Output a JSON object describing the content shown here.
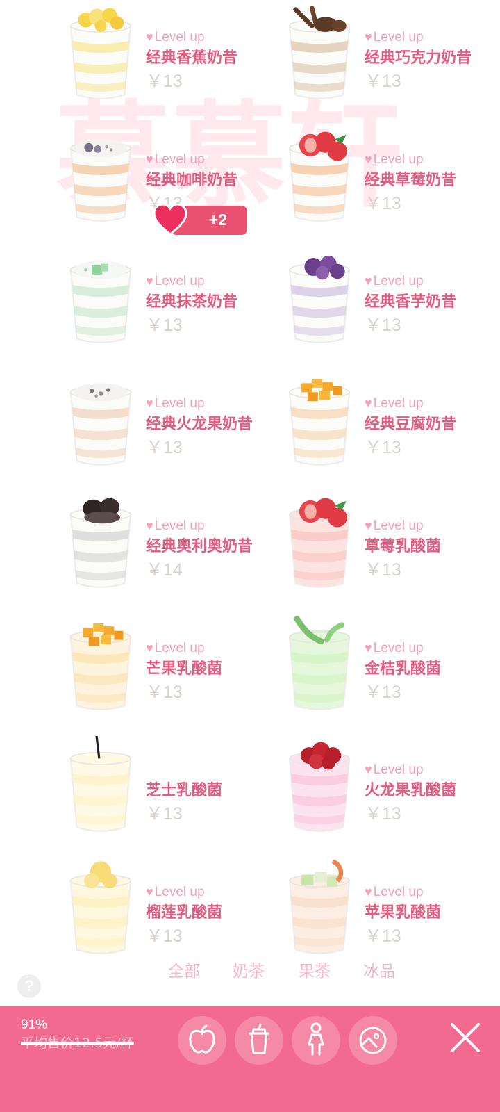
{
  "watermark": "慕慕轩",
  "level_label": "Level up",
  "items": [
    {
      "name": "经典香蕉奶昔",
      "price": "￥13",
      "topping": "banana",
      "level": true
    },
    {
      "name": "经典巧克力奶昔",
      "price": "￥13",
      "topping": "chocolate",
      "level": true
    },
    {
      "name": "经典咖啡奶昔",
      "price": "￥13",
      "topping": "coffee",
      "level": true
    },
    {
      "name": "经典草莓奶昔",
      "price": "￥13",
      "topping": "strawberry",
      "level": true
    },
    {
      "name": "经典抹茶奶昔",
      "price": "￥13",
      "topping": "matcha",
      "level": true
    },
    {
      "name": "经典香芋奶昔",
      "price": "￥13",
      "topping": "taro",
      "level": true
    },
    {
      "name": "经典火龙果奶昔",
      "price": "￥13",
      "topping": "dragonfruit-seeds",
      "level": true
    },
    {
      "name": "经典豆腐奶昔",
      "price": "￥13",
      "topping": "mango",
      "level": true
    },
    {
      "name": "经典奥利奥奶昔",
      "price": "￥14",
      "topping": "oreo",
      "level": true
    },
    {
      "name": "草莓乳酸菌",
      "price": "￥13",
      "topping": "strawberry",
      "level": true
    },
    {
      "name": "芒果乳酸菌",
      "price": "￥13",
      "topping": "mango",
      "level": true
    },
    {
      "name": "金桔乳酸菌",
      "price": "￥13",
      "topping": "leaves",
      "level": true
    },
    {
      "name": "芝士乳酸菌",
      "price": "￥13",
      "topping": "straw",
      "level": false
    },
    {
      "name": "火龙果乳酸菌",
      "price": "￥13",
      "topping": "dragonfruit",
      "level": true
    },
    {
      "name": "榴莲乳酸菌",
      "price": "￥13",
      "topping": "durian",
      "level": true
    },
    {
      "name": "苹果乳酸菌",
      "price": "￥13",
      "topping": "apple",
      "level": true
    }
  ],
  "toast": {
    "value": "+2"
  },
  "tabs": [
    "全部",
    "奶茶",
    "果茶",
    "冰品"
  ],
  "help_icon": "?",
  "bottom_bar": {
    "percent": "91%",
    "avg_price": "平均售价12.5元/杯",
    "buttons": [
      "apple-icon",
      "cup-icon",
      "person-icon",
      "image-icon"
    ],
    "close_icon": "close-icon"
  },
  "colors": {
    "accent": "#f26a8d",
    "name": "#e65c80",
    "level": "#f2a3b8",
    "price": "#d9d3cd"
  }
}
